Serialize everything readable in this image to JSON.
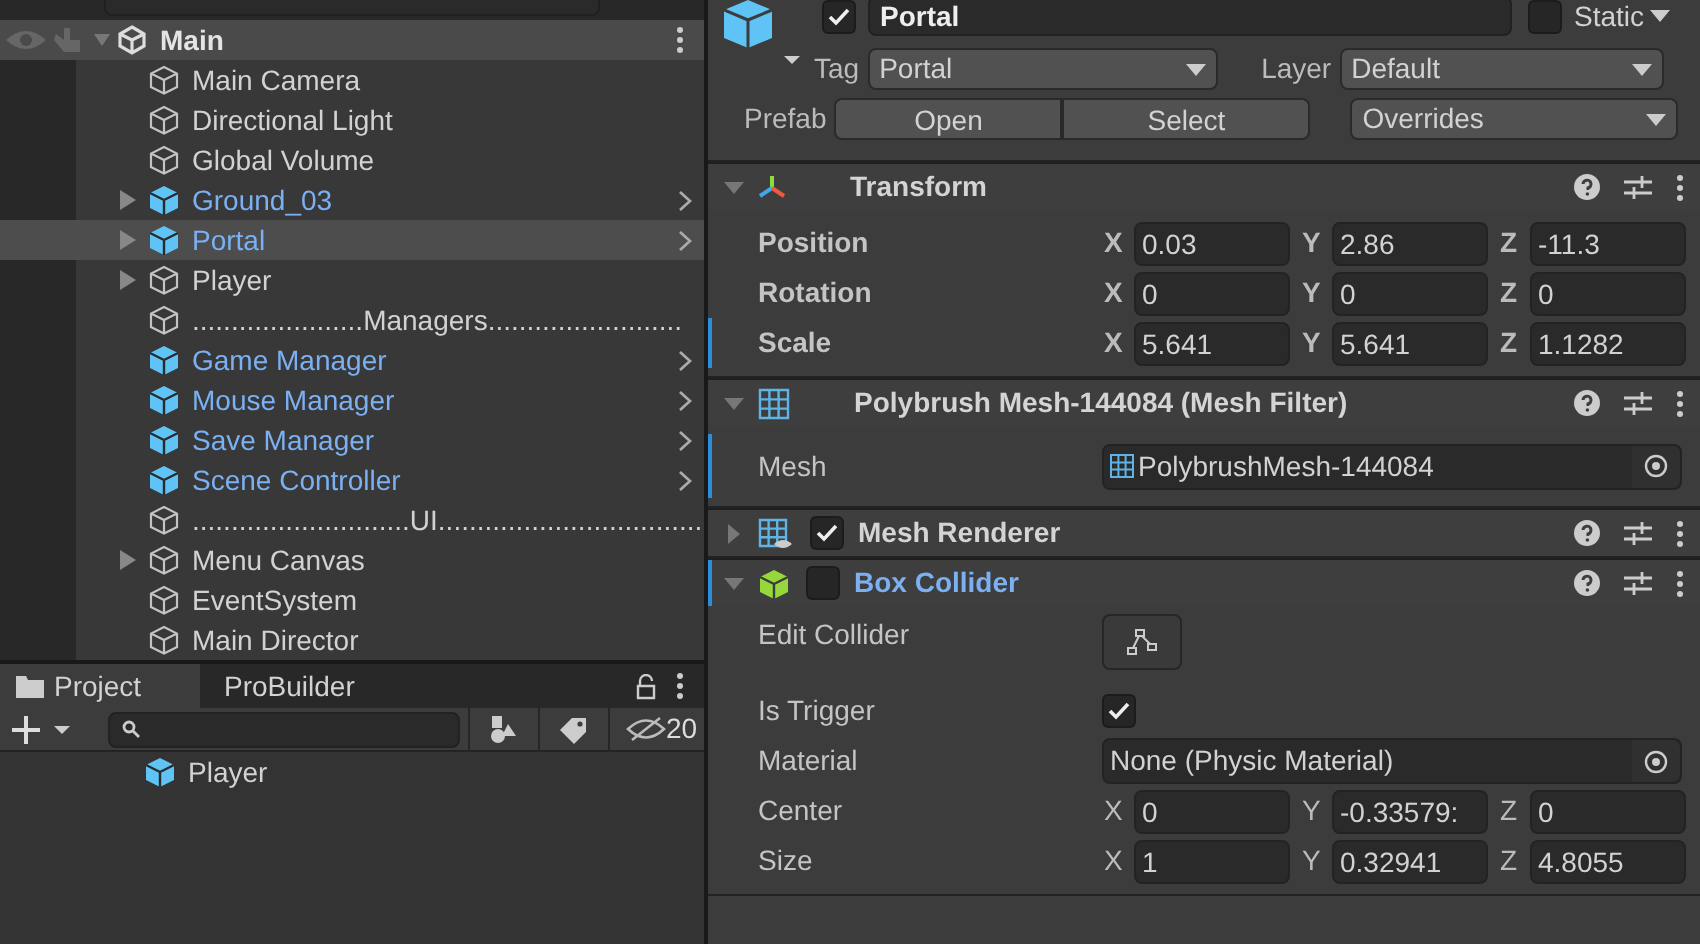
{
  "hierarchy": {
    "scene": {
      "name": "Main",
      "expanded": true,
      "children": [
        {
          "name": "Main Camera",
          "kind": "object",
          "expandable": false,
          "selected": false
        },
        {
          "name": "Directional Light",
          "kind": "object",
          "expandable": false,
          "selected": false
        },
        {
          "name": "Global Volume",
          "kind": "object",
          "expandable": false,
          "selected": false
        },
        {
          "name": "Ground_03",
          "kind": "prefab",
          "expandable": true,
          "selected": false
        },
        {
          "name": "Portal",
          "kind": "prefab",
          "expandable": true,
          "selected": true
        },
        {
          "name": "Player",
          "kind": "object",
          "expandable": true,
          "selected": false
        },
        {
          "name": "......................Managers.........................",
          "kind": "object",
          "expandable": false,
          "selected": false
        },
        {
          "name": "Game Manager",
          "kind": "prefab",
          "expandable": false,
          "selected": false
        },
        {
          "name": "Mouse Manager",
          "kind": "prefab",
          "expandable": false,
          "selected": false
        },
        {
          "name": "Save Manager",
          "kind": "prefab",
          "expandable": false,
          "selected": false
        },
        {
          "name": "Scene Controller",
          "kind": "prefab",
          "expandable": false,
          "selected": false
        },
        {
          "name": "............................UI...................................",
          "kind": "object",
          "expandable": false,
          "selected": false
        },
        {
          "name": "Menu Canvas",
          "kind": "object",
          "expandable": true,
          "selected": false
        },
        {
          "name": "EventSystem",
          "kind": "object",
          "expandable": false,
          "selected": false
        },
        {
          "name": "Main Director",
          "kind": "object",
          "expandable": false,
          "selected": false
        }
      ]
    }
  },
  "project": {
    "tabs": [
      {
        "label": "Project",
        "selected": true
      },
      {
        "label": "ProBuilder",
        "selected": false
      }
    ],
    "hidden_count": "20",
    "items": [
      {
        "name": "Player",
        "kind": "prefab"
      }
    ]
  },
  "inspector": {
    "name": "Portal",
    "active": true,
    "static": false,
    "static_label": "Static",
    "tag_label": "Tag",
    "tag": "Portal",
    "layer_label": "Layer",
    "layer": "Default",
    "prefab_label": "Prefab",
    "prefab_buttons": [
      "Open",
      "Select"
    ],
    "overrides": "Overrides",
    "components": [
      {
        "title": "Transform",
        "kind": "transform",
        "expanded": true,
        "overridden": false,
        "rows": [
          {
            "label": "Position",
            "kind": "vector",
            "overridden": false,
            "axes": [
              {
                "label": "X",
                "value": "0.03"
              },
              {
                "label": "Y",
                "value": "2.86"
              },
              {
                "label": "Z",
                "value": "-11.3"
              }
            ]
          },
          {
            "label": "Rotation",
            "kind": "vector",
            "overridden": false,
            "axes": [
              {
                "label": "X",
                "value": "0"
              },
              {
                "label": "Y",
                "value": "0"
              },
              {
                "label": "Z",
                "value": "0"
              }
            ]
          },
          {
            "label": "Scale",
            "kind": "vector",
            "overridden": true,
            "axes": [
              {
                "label": "X",
                "value": "5.641"
              },
              {
                "label": "Y",
                "value": "5.641"
              },
              {
                "label": "Z",
                "value": "1.1282"
              }
            ]
          }
        ]
      },
      {
        "title": "Polybrush Mesh-144084 (Mesh Filter)",
        "kind": "meshfilter",
        "expanded": true,
        "overridden": false,
        "rows": [
          {
            "label": "Mesh",
            "kind": "mesh",
            "overridden": true,
            "value": "PolybrushMesh-144084"
          }
        ]
      },
      {
        "title": "Mesh Renderer",
        "kind": "meshrenderer",
        "expanded": false,
        "enabled": true,
        "overridden": false
      },
      {
        "title": "Box Collider",
        "kind": "boxcollider",
        "expanded": true,
        "enabled": false,
        "overridden": true,
        "rows": [
          {
            "label": "Edit Collider",
            "kind": "edit",
            "overridden": false
          },
          {
            "label": "Is Trigger",
            "kind": "toggle",
            "overridden": false,
            "checked": true
          },
          {
            "label": "Material",
            "kind": "object",
            "overridden": false,
            "value": "None (Physic Material)"
          },
          {
            "label": "Center",
            "kind": "vector",
            "overridden": false,
            "axes": [
              {
                "label": "X",
                "value": "0"
              },
              {
                "label": "Y",
                "value": "-0.33579:"
              },
              {
                "label": "Z",
                "value": "0"
              }
            ]
          },
          {
            "label": "Size",
            "kind": "vector",
            "overridden": false,
            "axes": [
              {
                "label": "X",
                "value": "1"
              },
              {
                "label": "Y",
                "value": "0.32941"
              },
              {
                "label": "Z",
                "value": "4.8055"
              }
            ]
          }
        ]
      }
    ]
  }
}
